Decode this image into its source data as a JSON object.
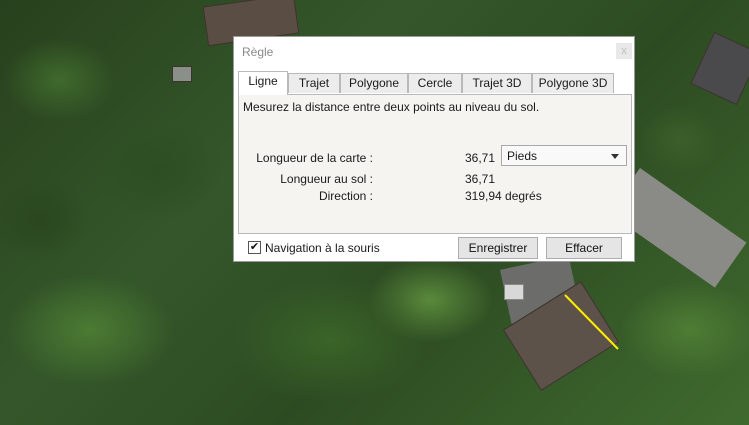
{
  "dialog": {
    "title": "Règle",
    "close_glyph": "x",
    "tabs": [
      {
        "label": "Ligne",
        "active": true
      },
      {
        "label": "Trajet",
        "active": false
      },
      {
        "label": "Polygone",
        "active": false
      },
      {
        "label": "Cercle",
        "active": false
      },
      {
        "label": "Trajet 3D",
        "active": false
      },
      {
        "label": "Polygone 3D",
        "active": false
      }
    ],
    "description": "Mesurez la distance entre deux points au niveau du sol.",
    "map_length": {
      "label": "Longueur de la carte :",
      "value": "36,71"
    },
    "unit_select": {
      "value": "Pieds"
    },
    "ground_length": {
      "label": "Longueur au sol :",
      "value": "36,71"
    },
    "direction": {
      "label": "Direction :",
      "value": "319,94 degrés"
    },
    "navigation": {
      "label": "Navigation à la souris",
      "checked": true,
      "check_glyph": "✔"
    },
    "buttons": {
      "save": "Enregistrer",
      "clear": "Effacer"
    }
  },
  "colors": {
    "measure_line": "#ffee00",
    "panel_bg": "#f6f4f1"
  }
}
